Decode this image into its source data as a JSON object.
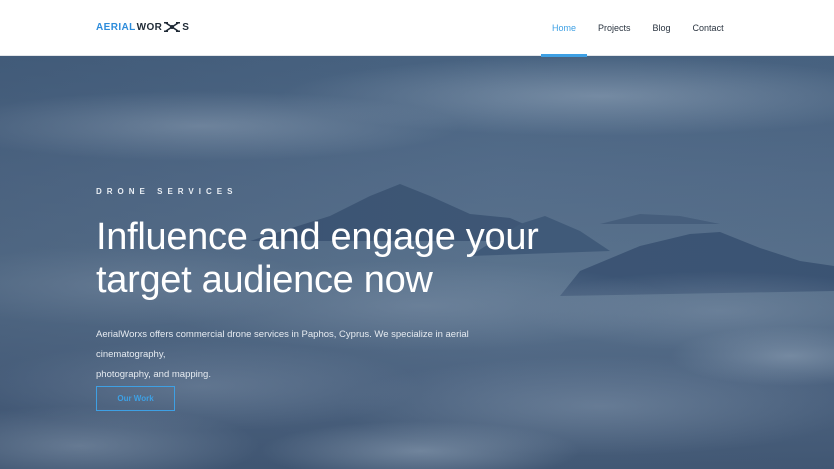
{
  "brand": {
    "logo_part1": "AERIAL",
    "logo_part2": "WOR",
    "logo_part3": "S",
    "icon": "drone-icon",
    "accent_color": "#3ea0e4"
  },
  "nav": {
    "items": [
      {
        "label": "Home",
        "active": true
      },
      {
        "label": "Projects",
        "active": false
      },
      {
        "label": "Blog",
        "active": false
      },
      {
        "label": "Contact",
        "active": false
      }
    ]
  },
  "hero": {
    "eyebrow": "DRONE SERVICES",
    "headline_line1": "Influence and engage your",
    "headline_line2": "target audience now",
    "lead_line1": "AerialWorxs offers commercial drone services in Paphos, Cyprus. We specialize in aerial cinematography,",
    "lead_line2": "photography, and mapping.",
    "cta_label": "Our Work"
  }
}
